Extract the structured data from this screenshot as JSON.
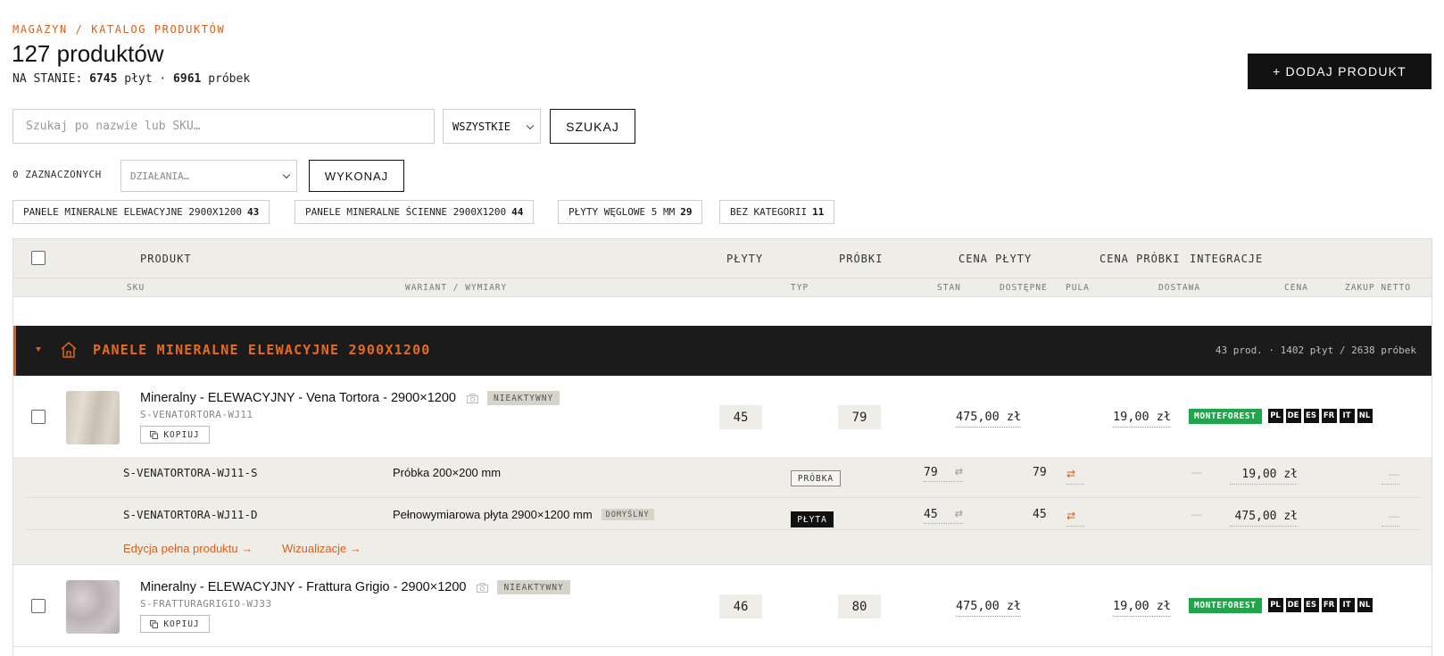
{
  "header": {
    "breadcrumb": "MAGAZYN / KATALOG PRODUKTÓW",
    "title": "127 produktów",
    "stock_prefix": "NA STANIE:",
    "stock_plates": "6745",
    "stock_plates_unit": "płyt",
    "stock_sep": "·",
    "stock_samples": "6961",
    "stock_samples_unit": "próbek",
    "add_button": "+ DODAJ PRODUKT"
  },
  "search": {
    "placeholder": "Szukaj po nazwie lub SKU…",
    "filter_value": "WSZYSTKIE",
    "button": "SZUKAJ"
  },
  "bulk": {
    "selected": "0 ZAZNACZONYCH",
    "actions_placeholder": "DZIAŁANIA…",
    "execute": "WYKONAJ"
  },
  "categories": [
    {
      "label": "PANELE MINERALNE ELEWACYJNE 2900X1200",
      "count": "43"
    },
    {
      "label": "PANELE MINERALNE ŚCIENNE 2900X1200",
      "count": "44"
    },
    {
      "label": "PŁYTY WĘGLOWE 5 MM",
      "count": "29"
    },
    {
      "label": "BEZ KATEGORII",
      "count": "11"
    }
  ],
  "table": {
    "head1": {
      "product": "PRODUKT",
      "plates": "PŁYTY",
      "samples": "PRÓBKI",
      "plate_price": "CENA PŁYTY",
      "sample_price": "CENA PRÓBKI",
      "integrations": "INTEGRACJE"
    },
    "head2": {
      "sku": "SKU",
      "variant": "WARIANT / WYMIARY",
      "type": "TYP",
      "stock": "STAN",
      "available": "DOSTĘPNE",
      "pool": "PULA",
      "delivery": "DOSTAWA",
      "price": "CENA",
      "net": "ZAKUP NETTO"
    },
    "group": {
      "title": "PANELE MINERALNE ELEWACYJNE 2900X1200",
      "meta": "43 prod. · 1402 płyt / 2638 próbek"
    },
    "products": [
      {
        "name": "Mineralny - ELEWACYJNY - Vena Tortora - 2900×1200",
        "sku": "S-VENATORTORA-WJ11",
        "status": "NIEAKTYWNY",
        "copy": "KOPIUJ",
        "plates": "45",
        "samples": "79",
        "plate_price": "475,00 zł",
        "sample_price": "19,00 zł",
        "integration": "MONTEFOREST",
        "langs": [
          "PL",
          "DE",
          "ES",
          "FR",
          "IT",
          "NL"
        ]
      },
      {
        "name": "Mineralny - ELEWACYJNY - Frattura Grigio - 2900×1200",
        "sku": "S-FRATTURAGRIGIO-WJ33",
        "status": "NIEAKTYWNY",
        "copy": "KOPIUJ",
        "plates": "46",
        "samples": "80",
        "plate_price": "475,00 zł",
        "sample_price": "19,00 zł",
        "integration": "MONTEFOREST",
        "langs": [
          "PL",
          "DE",
          "ES",
          "FR",
          "IT",
          "NL"
        ]
      }
    ],
    "variants": [
      {
        "sku": "S-VENATORTORA-WJ11-S",
        "name": "Próbka 200×200 mm",
        "default": "",
        "type": "PRÓBKA",
        "stock": "79",
        "available": "79",
        "delivery": "—",
        "price": "19,00 zł",
        "net": "—"
      },
      {
        "sku": "S-VENATORTORA-WJ11-D",
        "name": "Pełnowymiarowa płyta 2900×1200 mm",
        "default": "DOMYŚLNY",
        "type": "PŁYTA",
        "stock": "45",
        "available": "45",
        "delivery": "—",
        "price": "475,00 zł",
        "net": "—"
      }
    ],
    "links": {
      "edit": "Edycja pełna produktu →",
      "visual": "Wizualizacje →"
    }
  }
}
